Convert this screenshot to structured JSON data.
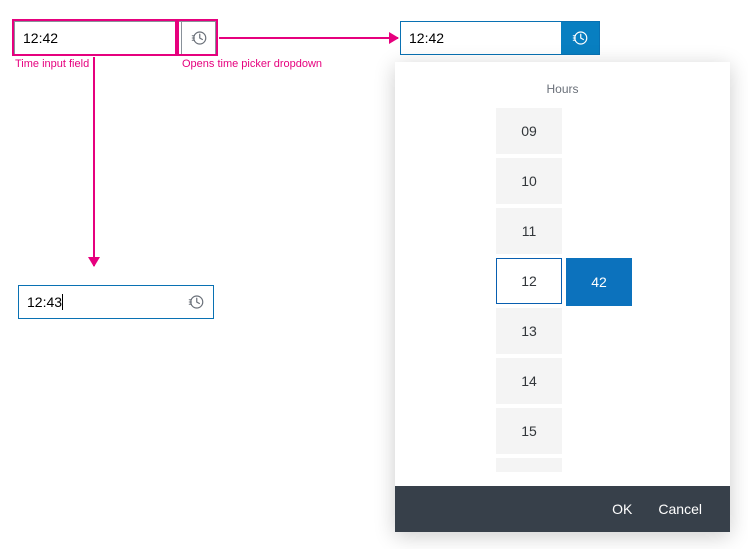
{
  "annotated": {
    "value": "12:42",
    "caption_field": "Time input field",
    "caption_icon": "Opens time picker dropdown"
  },
  "focused": {
    "value": "12:43"
  },
  "active": {
    "value": "12:42"
  },
  "dropdown": {
    "header": "Hours",
    "hours": [
      "09",
      "10",
      "11",
      "12",
      "13",
      "14",
      "15"
    ],
    "selected_hour": "12",
    "minute": "42",
    "ok_label": "OK",
    "cancel_label": "Cancel"
  },
  "colors": {
    "accent": "#e6007e",
    "brand": "#0971b3",
    "brand_fill": "#0c72bd",
    "footer": "#37404a"
  }
}
